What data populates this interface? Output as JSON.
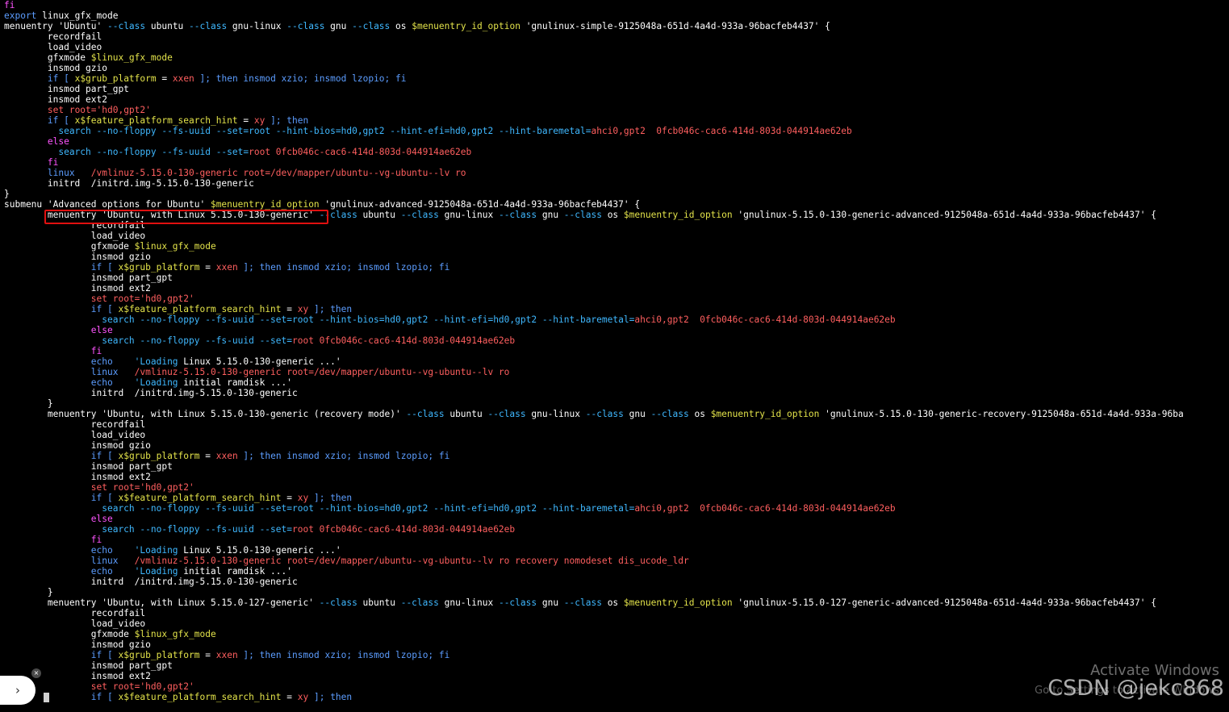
{
  "terminal": {
    "lines": [
      [
        [
          "fi",
          "p"
        ]
      ],
      [
        [
          "export",
          "b"
        ],
        [
          " linux_gfx_mode",
          "w"
        ]
      ],
      [
        [
          "menuentry 'Ubuntu' ",
          "w"
        ],
        [
          "--class",
          "c"
        ],
        [
          " ubuntu ",
          "w"
        ],
        [
          "--class",
          "c"
        ],
        [
          " gnu-linux ",
          "w"
        ],
        [
          "--class",
          "c"
        ],
        [
          " gnu ",
          "w"
        ],
        [
          "--class",
          "c"
        ],
        [
          " os ",
          "w"
        ],
        [
          "$menuentry_id_option",
          "y"
        ],
        [
          " 'gnulinux-simple-9125048a-651d-4a4d-933a-96bacfeb4437' {",
          "w"
        ]
      ],
      [
        [
          "        recordfail",
          "w"
        ]
      ],
      [
        [
          "        load_video",
          "w"
        ]
      ],
      [
        [
          "        gfxmode ",
          "w"
        ],
        [
          "$linux_gfx_mode",
          "y"
        ]
      ],
      [
        [
          "        insmod gzio",
          "w"
        ]
      ],
      [
        [
          "        ",
          "w"
        ],
        [
          "if [ ",
          "b"
        ],
        [
          "x$grub_platform",
          "y"
        ],
        [
          " = ",
          "w"
        ],
        [
          "xxen",
          "r"
        ],
        [
          " ]; then insmod xzio; insmod lzopio; fi",
          "b"
        ]
      ],
      [
        [
          "        insmod part_gpt",
          "w"
        ]
      ],
      [
        [
          "        insmod ext2",
          "w"
        ]
      ],
      [
        [
          "        ",
          "w"
        ],
        [
          "set root=",
          "r"
        ],
        [
          "'hd0,gpt2'",
          "r"
        ]
      ],
      [
        [
          "        ",
          "w"
        ],
        [
          "if [ ",
          "b"
        ],
        [
          "x$feature_platform_search_hint",
          "y"
        ],
        [
          " = ",
          "w"
        ],
        [
          "xy",
          "r"
        ],
        [
          " ]; then",
          "b"
        ]
      ],
      [
        [
          "          search ",
          "c"
        ],
        [
          "--no-floppy --fs-uuid --set=root --hint-bios=hd0,gpt2 --hint-efi=hd0,gpt2 --hint-baremetal=",
          "c"
        ],
        [
          "ahci0,gpt2  0fcb046c-cac6-414d-803d-044914ae62eb",
          "r"
        ]
      ],
      [
        [
          "        ",
          "w"
        ],
        [
          "else",
          "p"
        ]
      ],
      [
        [
          "          search ",
          "c"
        ],
        [
          "--no-floppy --fs-uuid --set=",
          "c"
        ],
        [
          "root 0fcb046c-cac6-414d-803d-044914ae62eb",
          "r"
        ]
      ],
      [
        [
          "        ",
          "w"
        ],
        [
          "fi",
          "p"
        ]
      ],
      [
        [
          "        linux   ",
          "b"
        ],
        [
          "/vmlinuz-5.15.0-130-generic root=",
          "r"
        ],
        [
          "/dev/mapper/ubuntu--vg-ubuntu--lv ro",
          "r"
        ]
      ],
      [
        [
          "        initrd  /initrd.img-5.15.0-130-generic",
          "w"
        ]
      ],
      [
        [
          "}",
          "w"
        ]
      ],
      [
        [
          "submenu 'Advanced options for Ubuntu' ",
          "w"
        ],
        [
          "$menuentry_id_option",
          "y"
        ],
        [
          " 'gnulinux-advanced-9125048a-651d-4a4d-933a-96bacfeb4437' {",
          "w"
        ]
      ],
      [
        [
          "        menuentry 'Ubuntu, with Linux 5.15.0-130-generic' ",
          "w"
        ],
        [
          "--class",
          "c"
        ],
        [
          " ubuntu ",
          "w"
        ],
        [
          "--class",
          "c"
        ],
        [
          " gnu-linux ",
          "w"
        ],
        [
          "--class",
          "c"
        ],
        [
          " gnu ",
          "w"
        ],
        [
          "--class",
          "c"
        ],
        [
          " os ",
          "w"
        ],
        [
          "$menuentry_id_option",
          "y"
        ],
        [
          " 'gnulinux-5.15.0-130-generic-advanced-9125048a-651d-4a4d-933a-96bacfeb4437' {",
          "w"
        ]
      ],
      [
        [
          "                recordfail",
          "w"
        ]
      ],
      [
        [
          "                load_video",
          "w"
        ]
      ],
      [
        [
          "                gfxmode ",
          "w"
        ],
        [
          "$linux_gfx_mode",
          "y"
        ]
      ],
      [
        [
          "                insmod gzio",
          "w"
        ]
      ],
      [
        [
          "                ",
          "w"
        ],
        [
          "if [ ",
          "b"
        ],
        [
          "x$grub_platform",
          "y"
        ],
        [
          " = ",
          "w"
        ],
        [
          "xxen",
          "r"
        ],
        [
          " ]; then insmod xzio; insmod lzopio; fi",
          "b"
        ]
      ],
      [
        [
          "                insmod part_gpt",
          "w"
        ]
      ],
      [
        [
          "                insmod ext2",
          "w"
        ]
      ],
      [
        [
          "                ",
          "w"
        ],
        [
          "set root=",
          "r"
        ],
        [
          "'hd0,gpt2'",
          "r"
        ]
      ],
      [
        [
          "                ",
          "w"
        ],
        [
          "if [ ",
          "b"
        ],
        [
          "x$feature_platform_search_hint",
          "y"
        ],
        [
          " = ",
          "w"
        ],
        [
          "xy",
          "r"
        ],
        [
          " ]; then",
          "b"
        ]
      ],
      [
        [
          "                  search ",
          "c"
        ],
        [
          "--no-floppy --fs-uuid --set=root --hint-bios=hd0,gpt2 --hint-efi=hd0,gpt2 --hint-baremetal=",
          "c"
        ],
        [
          "ahci0,gpt2  0fcb046c-cac6-414d-803d-044914ae62eb",
          "r"
        ]
      ],
      [
        [
          "                ",
          "w"
        ],
        [
          "else",
          "p"
        ]
      ],
      [
        [
          "                  search ",
          "c"
        ],
        [
          "--no-floppy --fs-uuid --set=",
          "c"
        ],
        [
          "root 0fcb046c-cac6-414d-803d-044914ae62eb",
          "r"
        ]
      ],
      [
        [
          "                ",
          "w"
        ],
        [
          "fi",
          "p"
        ]
      ],
      [
        [
          "                echo    ",
          "b"
        ],
        [
          "'Loading",
          "c"
        ],
        [
          " Linux 5.15.0-130-generic ...'",
          "w"
        ]
      ],
      [
        [
          "                linux   ",
          "b"
        ],
        [
          "/vmlinuz-5.15.0-130-generic root=",
          "r"
        ],
        [
          "/dev/mapper/ubuntu--vg-ubuntu--lv ro",
          "r"
        ]
      ],
      [
        [
          "                echo    ",
          "b"
        ],
        [
          "'Loading",
          "c"
        ],
        [
          " initial ramdisk ...'",
          "w"
        ]
      ],
      [
        [
          "                initrd  /initrd.img-5.15.0-130-generic",
          "w"
        ]
      ],
      [
        [
          "        }",
          "w"
        ]
      ],
      [
        [
          "        menuentry 'Ubuntu, with Linux 5.15.0-130-generic (recovery mode)' ",
          "w"
        ],
        [
          "--class",
          "c"
        ],
        [
          " ubuntu ",
          "w"
        ],
        [
          "--class",
          "c"
        ],
        [
          " gnu-linux ",
          "w"
        ],
        [
          "--class",
          "c"
        ],
        [
          " gnu ",
          "w"
        ],
        [
          "--class",
          "c"
        ],
        [
          " os ",
          "w"
        ],
        [
          "$menuentry_id_option",
          "y"
        ],
        [
          " 'gnulinux-5.15.0-130-generic-recovery-9125048a-651d-4a4d-933a-96ba",
          "w"
        ]
      ],
      [
        [
          "                recordfail",
          "w"
        ]
      ],
      [
        [
          "                load_video",
          "w"
        ]
      ],
      [
        [
          "                insmod gzio",
          "w"
        ]
      ],
      [
        [
          "                ",
          "w"
        ],
        [
          "if [ ",
          "b"
        ],
        [
          "x$grub_platform",
          "y"
        ],
        [
          " = ",
          "w"
        ],
        [
          "xxen",
          "r"
        ],
        [
          " ]; then insmod xzio; insmod lzopio; fi",
          "b"
        ]
      ],
      [
        [
          "                insmod part_gpt",
          "w"
        ]
      ],
      [
        [
          "                insmod ext2",
          "w"
        ]
      ],
      [
        [
          "                ",
          "w"
        ],
        [
          "set root=",
          "r"
        ],
        [
          "'hd0,gpt2'",
          "r"
        ]
      ],
      [
        [
          "                ",
          "w"
        ],
        [
          "if [ ",
          "b"
        ],
        [
          "x$feature_platform_search_hint",
          "y"
        ],
        [
          " = ",
          "w"
        ],
        [
          "xy",
          "r"
        ],
        [
          " ]; then",
          "b"
        ]
      ],
      [
        [
          "                  search ",
          "c"
        ],
        [
          "--no-floppy --fs-uuid --set=root --hint-bios=hd0,gpt2 --hint-efi=hd0,gpt2 --hint-baremetal=",
          "c"
        ],
        [
          "ahci0,gpt2  0fcb046c-cac6-414d-803d-044914ae62eb",
          "r"
        ]
      ],
      [
        [
          "                ",
          "w"
        ],
        [
          "else",
          "p"
        ]
      ],
      [
        [
          "                  search ",
          "c"
        ],
        [
          "--no-floppy --fs-uuid --set=",
          "c"
        ],
        [
          "root 0fcb046c-cac6-414d-803d-044914ae62eb",
          "r"
        ]
      ],
      [
        [
          "                ",
          "w"
        ],
        [
          "fi",
          "p"
        ]
      ],
      [
        [
          "                echo    ",
          "b"
        ],
        [
          "'Loading",
          "c"
        ],
        [
          " Linux 5.15.0-130-generic ...'",
          "w"
        ]
      ],
      [
        [
          "                linux   ",
          "b"
        ],
        [
          "/vmlinuz-5.15.0-130-generic root=",
          "r"
        ],
        [
          "/dev/mapper/ubuntu--vg-ubuntu--lv ro recovery nomodeset dis_ucode_ldr",
          "r"
        ]
      ],
      [
        [
          "                echo    ",
          "b"
        ],
        [
          "'Loading",
          "c"
        ],
        [
          " initial ramdisk ...'",
          "w"
        ]
      ],
      [
        [
          "                initrd  /initrd.img-5.15.0-130-generic",
          "w"
        ]
      ],
      [
        [
          "        }",
          "w"
        ]
      ],
      [
        [
          "        menuentry 'Ubuntu, with Linux 5.15.0-127-generic' ",
          "w"
        ],
        [
          "--class",
          "c"
        ],
        [
          " ubuntu ",
          "w"
        ],
        [
          "--class",
          "c"
        ],
        [
          " gnu-linux ",
          "w"
        ],
        [
          "--class",
          "c"
        ],
        [
          " gnu ",
          "w"
        ],
        [
          "--class",
          "c"
        ],
        [
          " os ",
          "w"
        ],
        [
          "$menuentry_id_option",
          "y"
        ],
        [
          " 'gnulinux-5.15.0-127-generic-advanced-9125048a-651d-4a4d-933a-96bacfeb4437' {",
          "w"
        ]
      ],
      [
        [
          "                recordfail",
          "w"
        ]
      ],
      [
        [
          "                load_video",
          "w"
        ]
      ],
      [
        [
          "                gfxmode ",
          "w"
        ],
        [
          "$linux_gfx_mode",
          "y"
        ]
      ],
      [
        [
          "                insmod gzio",
          "w"
        ]
      ],
      [
        [
          "                ",
          "w"
        ],
        [
          "if [ ",
          "b"
        ],
        [
          "x$grub_platform",
          "y"
        ],
        [
          " = ",
          "w"
        ],
        [
          "xxen",
          "r"
        ],
        [
          " ]; then insmod xzio; insmod lzopio; fi",
          "b"
        ]
      ],
      [
        [
          "                insmod part_gpt",
          "w"
        ]
      ],
      [
        [
          "                insmod ext2",
          "w"
        ]
      ],
      [
        [
          "                ",
          "w"
        ],
        [
          "set root=",
          "r"
        ],
        [
          "'hd0,gpt2'",
          "r"
        ]
      ],
      [
        [
          "                ",
          "w"
        ],
        [
          "if [ ",
          "b"
        ],
        [
          "x$feature_platform_search_hint",
          "y"
        ],
        [
          " = ",
          "w"
        ],
        [
          "xy",
          "r"
        ],
        [
          " ]; then",
          "b"
        ]
      ]
    ],
    "highlight_label": "menuentry 'Ubuntu, with Linux 5.15.0-130-generic'"
  },
  "overlay": {
    "side_tab_icon": "chevron-right-icon",
    "side_tab_glyph": "›",
    "close_glyph": "×",
    "activate_title": "Activate Windows",
    "activate_sub": "Go to Settings to activate Windows.",
    "watermark": "CSDN @jekc868"
  },
  "colors": {
    "background": "#000000",
    "text": "#ffffff",
    "keyword_magenta": "#ff55ff",
    "keyword_blue": "#5c9dff",
    "option_cyan": "#3fb8ff",
    "variable_yellow": "#e3e34a",
    "string_red": "#ff5f5f",
    "highlight_border": "#e01010"
  }
}
